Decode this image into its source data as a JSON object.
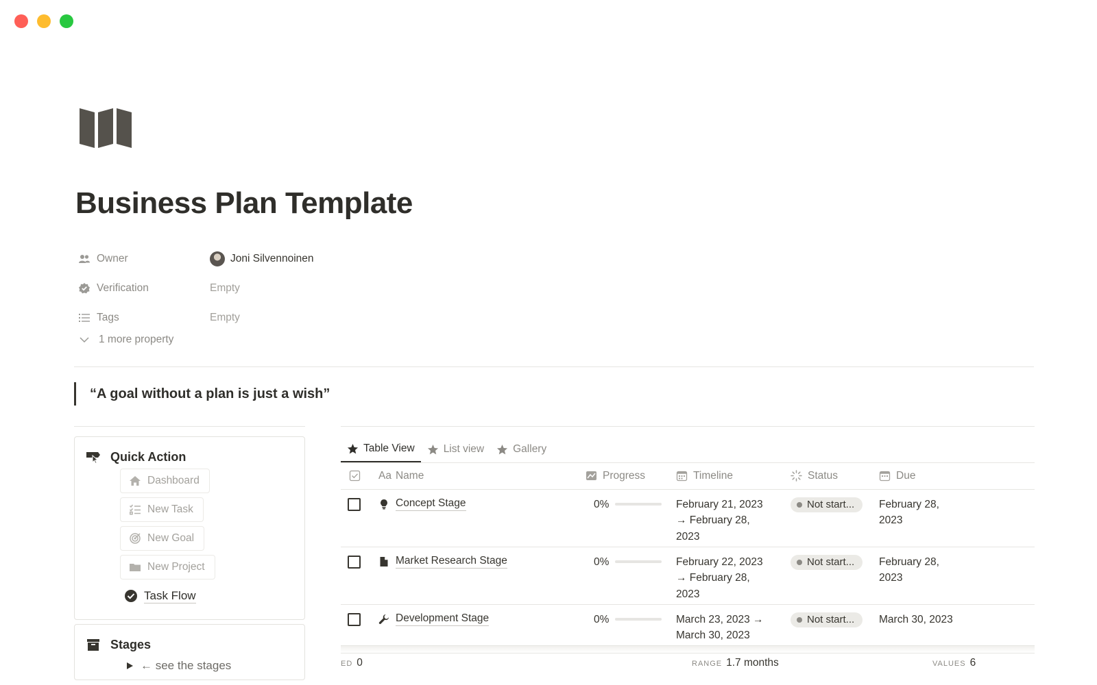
{
  "window": {
    "controls": [
      "close",
      "minimize",
      "maximize"
    ]
  },
  "page": {
    "icon": "map-icon",
    "title": "Business Plan Template"
  },
  "properties": {
    "owner": {
      "label": "Owner",
      "value": "Joni Silvennoinen"
    },
    "verification": {
      "label": "Verification",
      "value": "Empty"
    },
    "tags": {
      "label": "Tags",
      "value": "Empty"
    },
    "more": "1 more property"
  },
  "quote": "“A goal without a plan is just a wish”",
  "quick_action": {
    "title": "Quick Action",
    "buttons": [
      {
        "label": "Dashboard",
        "icon": "home-icon"
      },
      {
        "label": "New Task",
        "icon": "checklist-icon"
      },
      {
        "label": "New Goal",
        "icon": "target-icon"
      },
      {
        "label": "New Project",
        "icon": "folder-icon"
      }
    ],
    "task_flow": "Task Flow"
  },
  "stages": {
    "title": "Stages",
    "toggle": "← see the stages"
  },
  "views": {
    "tabs": [
      {
        "label": "Table View",
        "active": true
      },
      {
        "label": "List view",
        "active": false
      },
      {
        "label": "Gallery",
        "active": false
      }
    ]
  },
  "table": {
    "headers": {
      "name": "Name",
      "name_prefix": "Aa",
      "progress": "Progress",
      "timeline": "Timeline",
      "status": "Status",
      "due": "Due"
    },
    "rows": [
      {
        "name": "Concept Stage",
        "icon": "lightbulb-icon",
        "progress": "0%",
        "progress_value": 0,
        "timeline": [
          "February 21, 2023",
          "→ February 28,",
          "2023"
        ],
        "status": "Not start...",
        "due": [
          "February 28,",
          "2023"
        ]
      },
      {
        "name": "Market Research Stage",
        "icon": "document-icon",
        "progress": "0%",
        "progress_value": 0,
        "timeline": [
          "February 22, 2023",
          "→ February 28,",
          "2023"
        ],
        "status": "Not start...",
        "due": [
          "February 28,",
          "2023"
        ]
      },
      {
        "name": "Development Stage",
        "icon": "wrench-icon",
        "progress": "0%",
        "progress_value": 0,
        "timeline": [
          "March 23, 2023 →",
          "March 30, 2023"
        ],
        "status": "Not start...",
        "due": [
          "March 30, 2023"
        ]
      }
    ]
  },
  "calculations": {
    "checked": {
      "key": "ED",
      "value": "0"
    },
    "range": {
      "key": "RANGE",
      "value": "1.7 months"
    },
    "values": {
      "key": "VALUES",
      "value": "6"
    }
  },
  "colors": {
    "text": "#37352f",
    "muted": "#8c8a85",
    "border": "#e6e5e2",
    "pill": "#ebeae6"
  }
}
